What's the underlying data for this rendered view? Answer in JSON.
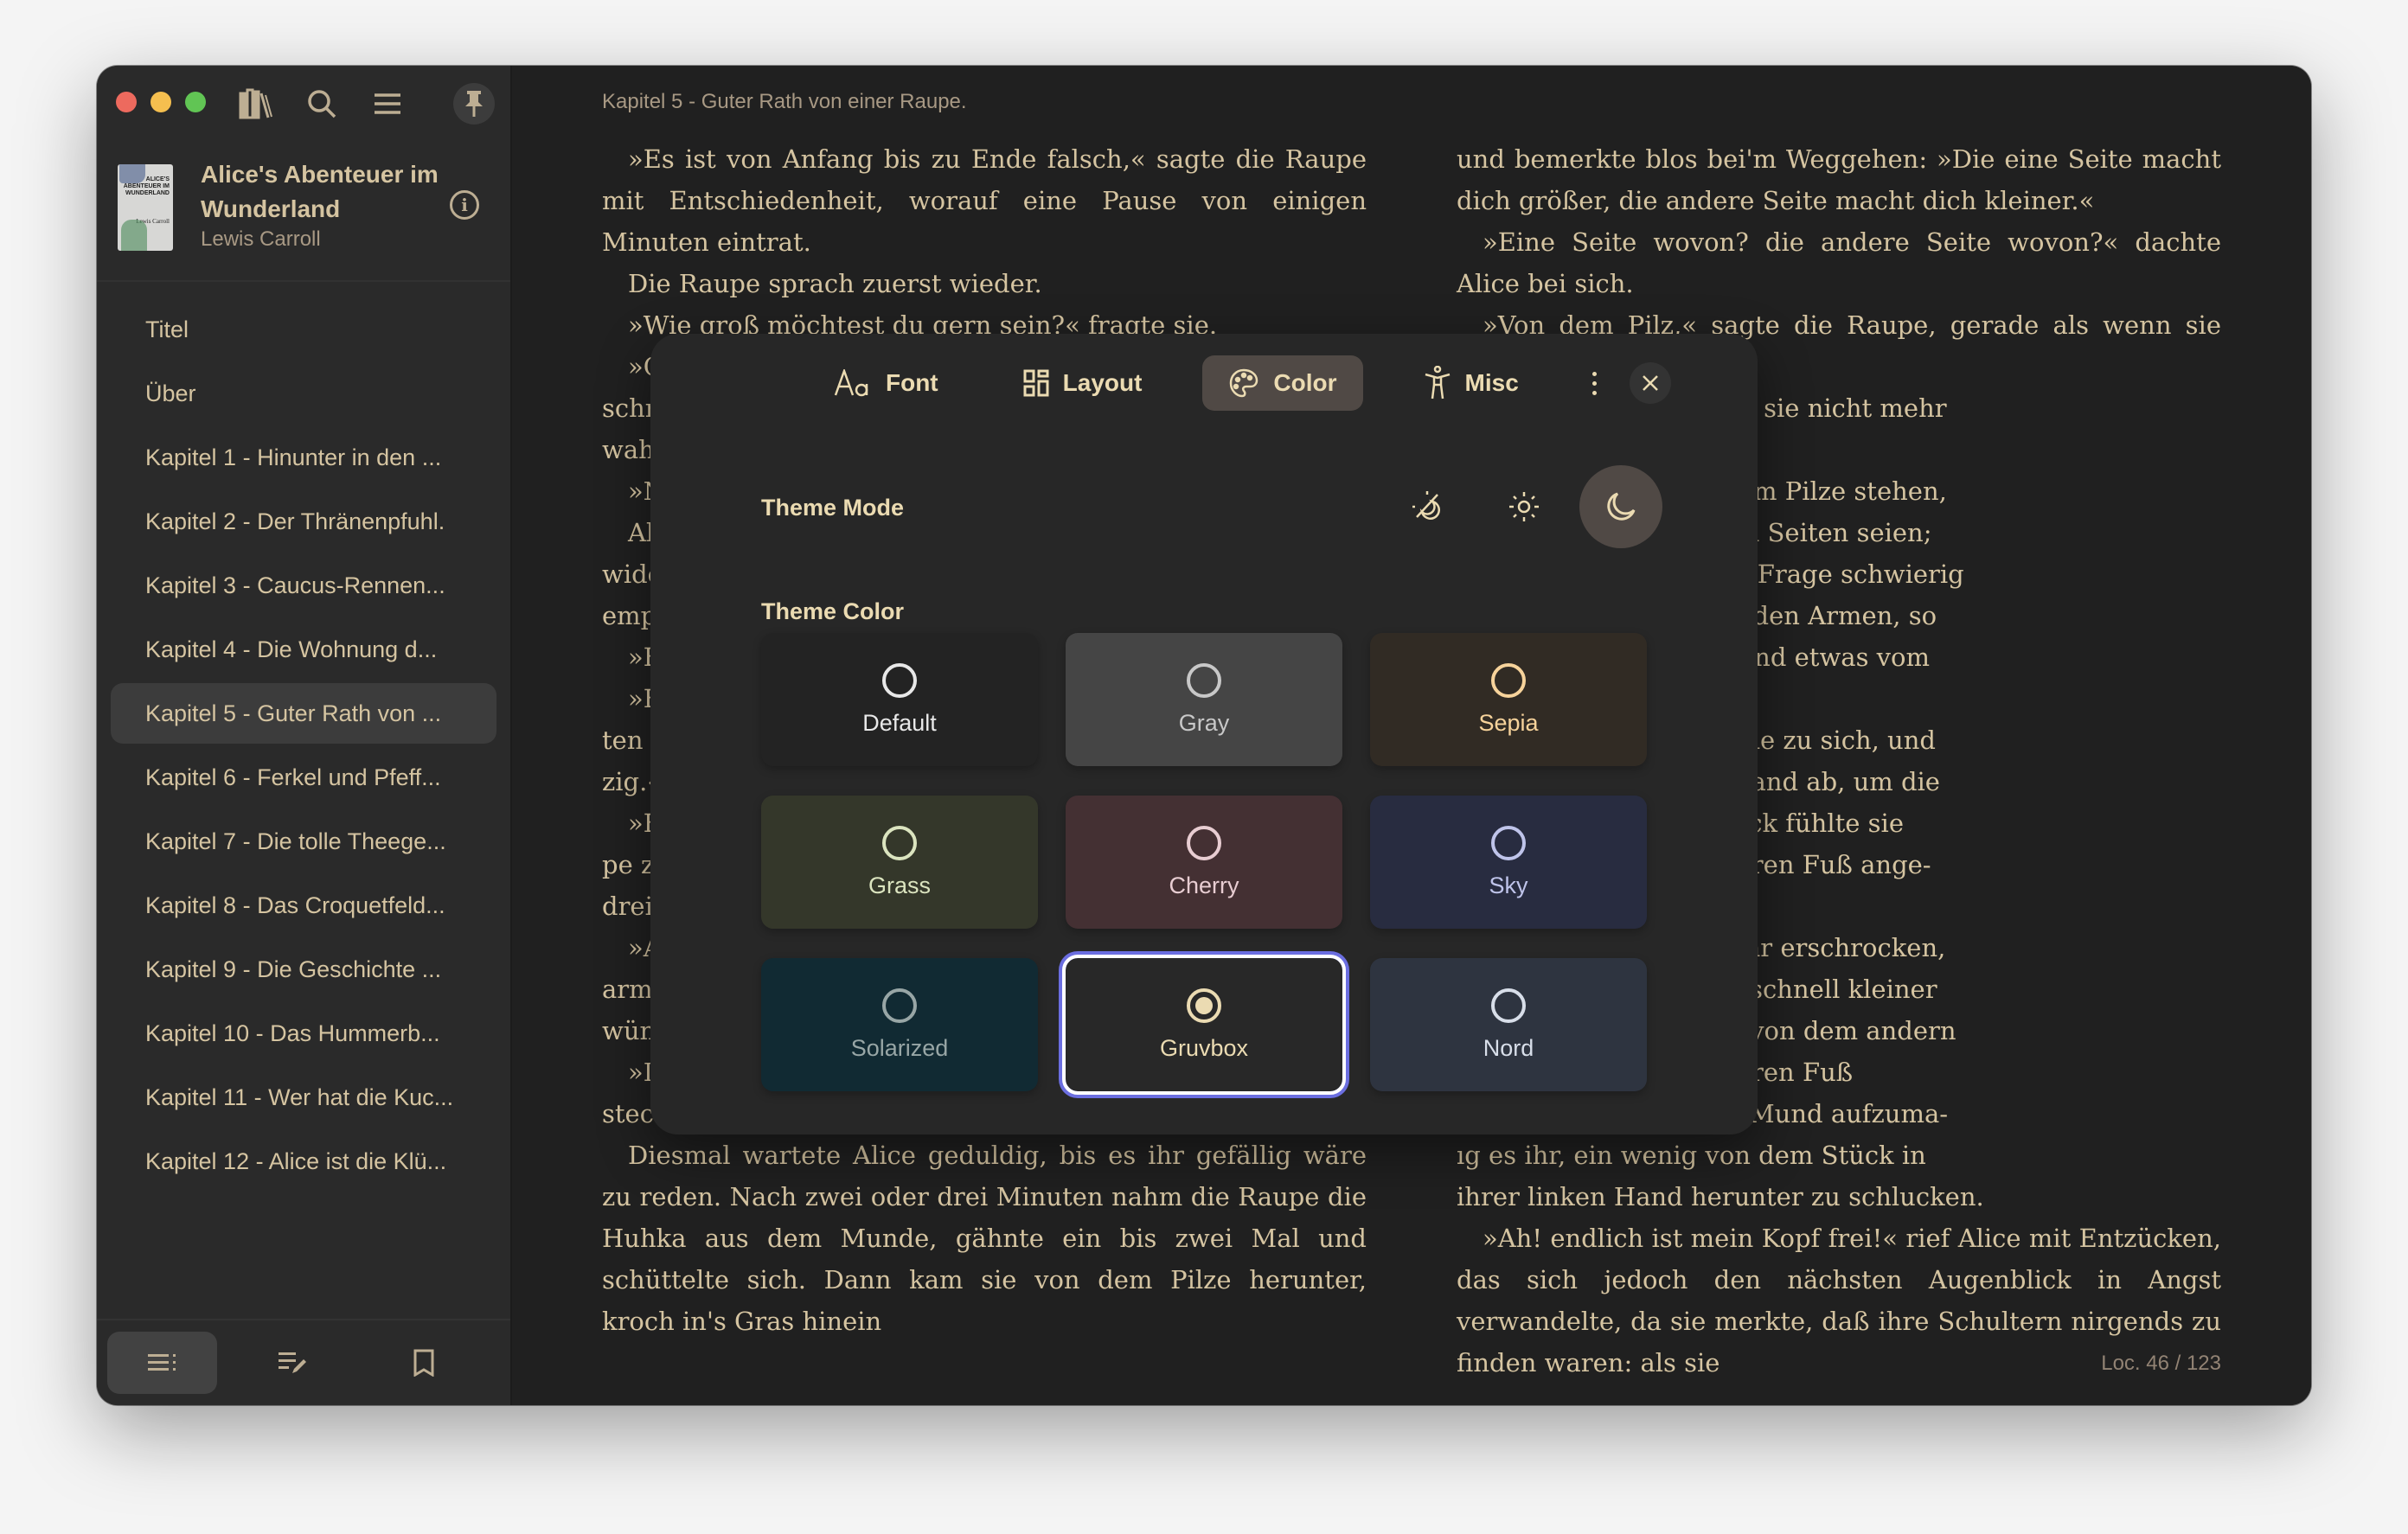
{
  "window": {
    "traffic_lights": [
      "close",
      "minimize",
      "maximize"
    ]
  },
  "sidebar": {
    "toolbar": [
      {
        "name": "library-icon"
      },
      {
        "name": "search-icon"
      },
      {
        "name": "menu-icon"
      },
      {
        "name": "pin-icon"
      }
    ],
    "book": {
      "title": "Alice's Abenteuer im Wunderland",
      "author": "Lewis Carroll",
      "cover_title": "ALICE'S ABENTEUER IM WUNDERLAND",
      "cover_author": "Lewis Carroll"
    },
    "toc": [
      {
        "label": "Titel",
        "active": false
      },
      {
        "label": "Über",
        "active": false
      },
      {
        "label": "Kapitel 1 - Hinunter in den ...",
        "active": false
      },
      {
        "label": "Kapitel 2 - Der Thränenpfuhl.",
        "active": false
      },
      {
        "label": "Kapitel 3 - Caucus-Rennen...",
        "active": false
      },
      {
        "label": "Kapitel 4 - Die Wohnung d...",
        "active": false
      },
      {
        "label": "Kapitel 5 - Guter Rath von ...",
        "active": true
      },
      {
        "label": "Kapitel 6 - Ferkel und Pfeff...",
        "active": false
      },
      {
        "label": "Kapitel 7 - Die tolle Theege...",
        "active": false
      },
      {
        "label": "Kapitel 8 - Das Croquetfeld...",
        "active": false
      },
      {
        "label": "Kapitel 9 - Die Geschichte ...",
        "active": false
      },
      {
        "label": "Kapitel 10 - Das Hummerb...",
        "active": false
      },
      {
        "label": "Kapitel 11 - Wer hat die Kuc...",
        "active": false
      },
      {
        "label": "Kapitel 12 - Alice ist die Klü...",
        "active": false
      }
    ],
    "bottom_tabs": [
      {
        "name": "toc-icon",
        "active": true
      },
      {
        "name": "annotations-icon",
        "active": false
      },
      {
        "name": "bookmark-icon",
        "active": false
      }
    ]
  },
  "reader": {
    "chapter_label": "Kapitel 5 - Guter Rath von einer Raupe.",
    "location": "Loc. 46 / 123",
    "left_column": [
      {
        "text": "»Es ist von Anfang bis zu Ende falsch,« sagte die Raupe mit Entschiedenheit, worauf eine Pause von einigen Minuten eintrat.",
        "indent": true
      },
      {
        "text": "Die Raupe sprach zuerst wieder.",
        "indent": true
      },
      {
        "text": "»Wie groß möchtest du gern sein?« fragte sie.",
        "indent": true
      },
      {
        "text": "»C",
        "indent": true
      },
      {
        "text": "schr",
        "indent": false
      },
      {
        "text": "wah",
        "indent": false
      },
      {
        "text": "»N",
        "indent": true
      },
      {
        "text": "Al",
        "indent": true
      },
      {
        "text": "wide",
        "indent": false
      },
      {
        "text": "emp",
        "indent": false
      },
      {
        "text": "»E",
        "indent": true
      },
      {
        "text": "»E",
        "indent": true
      },
      {
        "text": "ten",
        "indent": false
      },
      {
        "text": "zig.«",
        "indent": false
      },
      {
        "text": "»E",
        "indent": true
      },
      {
        "text": "pe z",
        "indent": false
      },
      {
        "text": "drei",
        "indent": false
      },
      {
        "text": "»A",
        "indent": true
      },
      {
        "text": "arm",
        "indent": false
      },
      {
        "text": "wün",
        "indent": false
      },
      {
        "text": "»D",
        "indent": true
      },
      {
        "text": "stec",
        "indent": false
      },
      {
        "text": "Diesmal wartete Alice geduldig, bis es ihr gefällig wäre zu reden. Nach zwei oder drei Minuten nahm die Raupe die Huhka aus dem Munde, gähnte ein bis zwei Mal und schüttelte sich. Dann kam sie von dem Pilze herunter, kroch in's Gras hinein",
        "indent": true
      }
    ],
    "right_column": [
      {
        "text": "und bemerkte blos bei'm Weggehen: »Die eine Seite macht dich größer, die andere Seite macht dich kleiner.«",
        "indent": false
      },
      {
        "text": "»Eine Seite wovon? die andere Seite wovon?« dachte Alice bei sich.",
        "indent": true
      },
      {
        "text": "»Von dem Pilz,« sagte die Raupe, gerade als wenn sie laut",
        "indent": true
      },
      {
        "text": "ichsten Augenblick war sie nicht mehr",
        "indent": false
      },
      {
        "text": "",
        "indent": false
      },
      {
        "text": "en gedankenvoll vor dem Pilze stehen,",
        "indent": false
      },
      {
        "text": "n, welches seine beiden Seiten seien;",
        "indent": false
      },
      {
        "text": "ınd war, so fand sie die Frage schwierig",
        "indent": false
      },
      {
        "text": "aber reichte sie mit beiden Armen, so",
        "indent": false
      },
      {
        "text": "und brach mit jeder Hand etwas vom",
        "indent": false
      },
      {
        "text": "",
        "indent": false
      },
      {
        "text": "t das rechte?« sprach sie zu sich, und",
        "indent": false
      },
      {
        "text": "tück in ihrer rechten Hand ab, um die",
        "indent": false
      },
      {
        "text": "den nächsten Augenblick fühlte sie",
        "indent": false
      },
      {
        "text": "am Kinn, es hatte an ihren Fuß ange-",
        "indent": false
      },
      {
        "text": "",
        "indent": false
      },
      {
        "text": "erwandlung war sie sehr erschrocken,",
        "indent": false
      },
      {
        "text": "ı verlieren, da sie sehr schnell kleiner",
        "indent": false
      },
      {
        "text": "so gleich daran, etwas von dem andern",
        "indent": false
      },
      {
        "text": "Kinn war so dicht an ihren Fuß",
        "indent": false
      },
      {
        "text": "Platz genug blieb, den Mund aufzuma-",
        "indent": false
      },
      {
        "text": "ıg es ihr, ein wenig von dem Stück in",
        "indent": false
      },
      {
        "text": "ihrer linken Hand herunter zu schlucken.",
        "indent": false
      },
      {
        "text": "»Ah! endlich ist mein Kopf frei!« rief Alice mit Entzücken, das sich jedoch den nächsten Augenblick in Angst verwandelte, da sie merkte, daß ihre Schultern nirgends zu finden waren: als sie",
        "indent": true
      }
    ]
  },
  "settings_modal": {
    "tabs": [
      {
        "label": "Font",
        "icon": "font-icon",
        "active": false
      },
      {
        "label": "Layout",
        "icon": "layout-icon",
        "active": false
      },
      {
        "label": "Color",
        "icon": "palette-icon",
        "active": true
      },
      {
        "label": "Misc",
        "icon": "accessibility-icon",
        "active": false
      }
    ],
    "theme_mode": {
      "label": "Theme Mode",
      "options": [
        {
          "name": "auto",
          "icon": "auto-theme-icon",
          "active": false
        },
        {
          "name": "light",
          "icon": "sun-icon",
          "active": false
        },
        {
          "name": "dark",
          "icon": "moon-icon",
          "active": true
        }
      ]
    },
    "theme_color": {
      "label": "Theme Color",
      "options": [
        {
          "label": "Default",
          "bg": "#232323",
          "fg": "#e8e8e8",
          "selected": false
        },
        {
          "label": "Gray",
          "bg": "#454545",
          "fg": "#c8c8c8",
          "selected": false
        },
        {
          "label": "Sepia",
          "bg": "#312b24",
          "fg": "#f7d39b",
          "selected": false
        },
        {
          "label": "Grass",
          "bg": "#34372a",
          "fg": "#dbe4bf",
          "selected": false
        },
        {
          "label": "Cherry",
          "bg": "#443033",
          "fg": "#e8cdd2",
          "selected": false
        },
        {
          "label": "Sky",
          "bg": "#282c40",
          "fg": "#bfc4ea",
          "selected": false
        },
        {
          "label": "Solarized",
          "bg": "#112a33",
          "fg": "#98a6a6",
          "selected": false
        },
        {
          "label": "Gruvbox",
          "bg": "#282828",
          "fg": "#ebdbb2",
          "selected": true
        },
        {
          "label": "Nord",
          "bg": "#2e3440",
          "fg": "#d8dee9",
          "selected": false
        }
      ]
    }
  },
  "colors": {
    "accent_text": "#d5c4a1",
    "selection_ring": "#6b6ee0"
  }
}
